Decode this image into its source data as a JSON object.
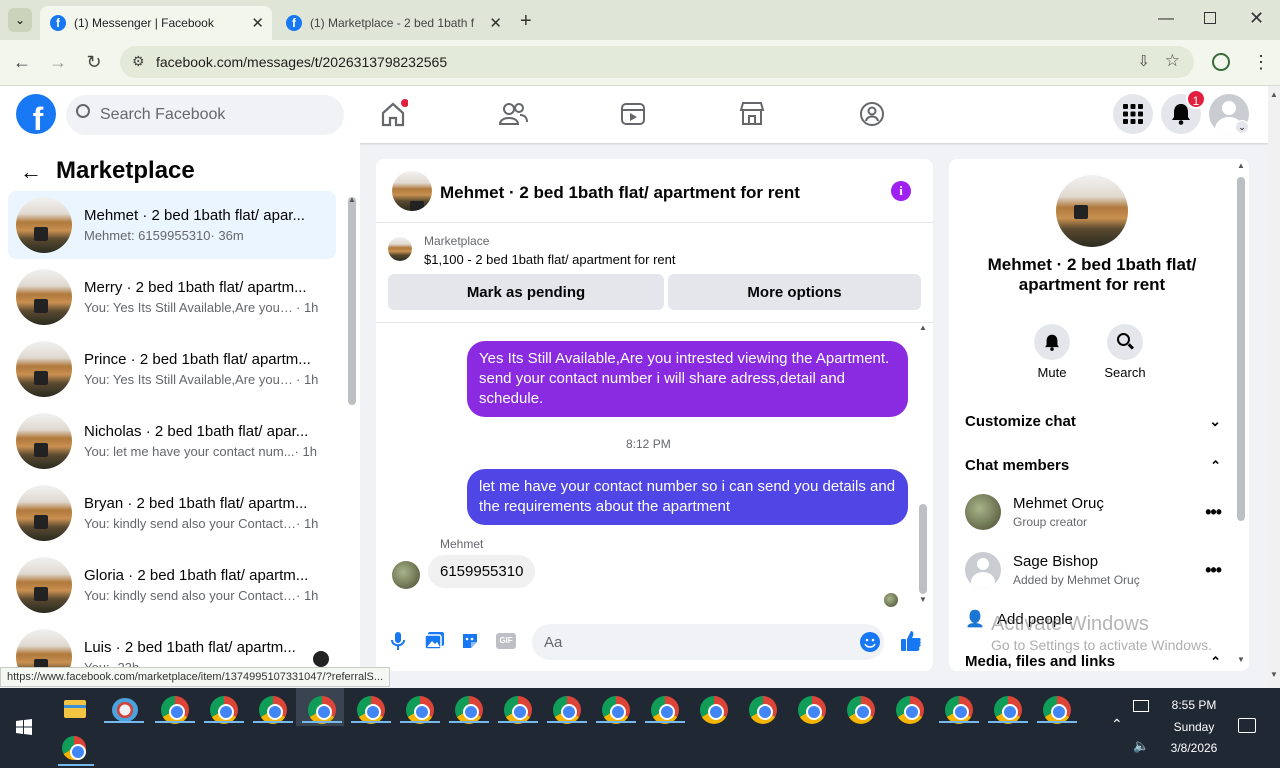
{
  "browser": {
    "tabs": [
      {
        "title": "(1) Messenger | Facebook",
        "active": true
      },
      {
        "title": "(1) Marketplace - 2 bed 1bath f",
        "active": false
      }
    ],
    "url": "facebook.com/messages/t/2026313798232565",
    "status_url": "https://www.facebook.com/marketplace/item/1374995107331047/?referralS..."
  },
  "fb": {
    "search_placeholder": "Search Facebook",
    "notifications_badge": "1"
  },
  "left": {
    "title": "Marketplace",
    "conversations": [
      {
        "name": "Mehmet · 2 bed 1bath flat/ apar...",
        "preview": "Mehmet: 6159955310",
        "time": "· 36m",
        "selected": true
      },
      {
        "name": "Merry · 2 bed 1bath flat/ apartm...",
        "preview": "You: Yes Its Still Available,Are you in...",
        "time": "· 1h"
      },
      {
        "name": "Prince · 2 bed 1bath flat/ apartm...",
        "preview": "You: Yes Its Still Available,Are you in...",
        "time": "· 1h"
      },
      {
        "name": "Nicholas · 2 bed 1bath flat/ apar...",
        "preview": "You: let me have your contact num...",
        "time": "· 1h"
      },
      {
        "name": "Bryan · 2 bed 1bath flat/ apartm...",
        "preview": "You: kindly send also your Contact ...",
        "time": "· 1h"
      },
      {
        "name": "Gloria · 2 bed 1bath flat/ apartm...",
        "preview": "You: kindly send also your Contact ...",
        "time": "· 1h"
      },
      {
        "name": "Luis · 2 bed 1bath flat/ apartm...",
        "preview": "You: ",
        "time": "· 23h"
      }
    ]
  },
  "chat": {
    "header_title": "Mehmet · 2 bed 1bath flat/ apartment for rent",
    "listing_source": "Marketplace",
    "listing_price_title": "$1,100 - 2 bed 1bath flat/ apartment for rent",
    "mark_pending": "Mark as pending",
    "more_options": "More options",
    "messages": [
      {
        "from": "me",
        "text": "Yes Its Still Available,Are you intrested viewing the Apartment. send your contact number i will share adress,detail and schedule."
      },
      {
        "from": "me",
        "text": "let me have your contact number so i can send you details and the requirements about the apartment"
      },
      {
        "from": "Mehmet",
        "text": "6159955310"
      }
    ],
    "timestamp": "8:12 PM",
    "sender_label": "Mehmet",
    "composer_placeholder": "Aa"
  },
  "details": {
    "title": "Mehmet · 2 bed 1bath flat/ apartment for rent",
    "mute": "Mute",
    "search": "Search",
    "customize": "Customize chat",
    "members_header": "Chat members",
    "members": [
      {
        "name": "Mehmet Oruç",
        "role": "Group creator"
      },
      {
        "name": "Sage Bishop",
        "role": "Added by Mehmet Oruç"
      }
    ],
    "add_people": "Add people",
    "media": "Media, files and links",
    "watermark_1": "Activate Windows",
    "watermark_2": "Go to Settings to activate Windows."
  },
  "taskbar": {
    "time": "8:55 PM",
    "day": "Sunday",
    "date": "3/8/2026"
  },
  "colors": {
    "fb_blue": "#1877f2",
    "purple_bubble": "#8a2be2",
    "blue_bubble": "#4f46e5",
    "taskbar": "#202833"
  }
}
